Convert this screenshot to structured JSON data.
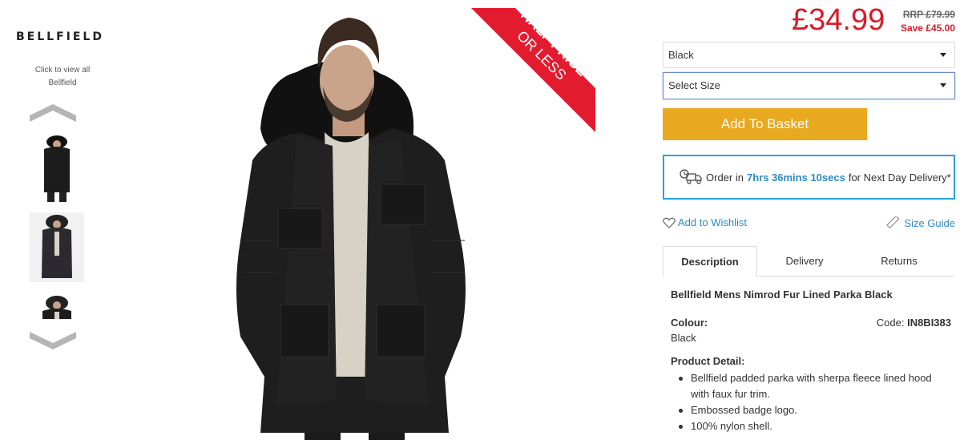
{
  "brand": {
    "logo_text": "BELLFIELD",
    "view_all": "Click to view all Bellfield"
  },
  "gallery": {
    "thumbnails": [
      "thumbnail-front",
      "thumbnail-studio",
      "thumbnail-detail"
    ]
  },
  "promo": {
    "sash_line1": "HALF PRICE",
    "sash_line2": "OR LESS",
    "sash_color": "#e31b2f"
  },
  "pricing": {
    "price": "£34.99",
    "rrp": "RRP £79.99",
    "save": "Save £45.00",
    "price_color": "#d71c2a"
  },
  "options": {
    "colour_selected": "Black",
    "size_placeholder": "Select Size"
  },
  "basket": {
    "label": "Add To Basket",
    "color": "#e8a820"
  },
  "delivery": {
    "prefix": "Order in",
    "countdown": "7hrs 36mins 10secs",
    "suffix": "for Next Day Delivery*",
    "border_color": "#2aa3d8"
  },
  "links": {
    "wishlist": "Add to Wishlist",
    "size_guide": "Size Guide",
    "link_color": "#2a8cc4"
  },
  "tabs": [
    {
      "label": "Description",
      "active": true
    },
    {
      "label": "Delivery",
      "active": false
    },
    {
      "label": "Returns",
      "active": false
    }
  ],
  "description": {
    "title": "Bellfield Mens Nimrod Fur Lined Parka Black",
    "colour_label": "Colour:",
    "colour_value": "Black",
    "code_label": "Code:",
    "code_value": "IN8BI383",
    "detail_heading": "Product Detail:",
    "bullets": [
      "Bellfield padded parka with sherpa fleece lined hood with faux fur trim.",
      "Embossed badge logo.",
      "100% nylon shell."
    ]
  }
}
